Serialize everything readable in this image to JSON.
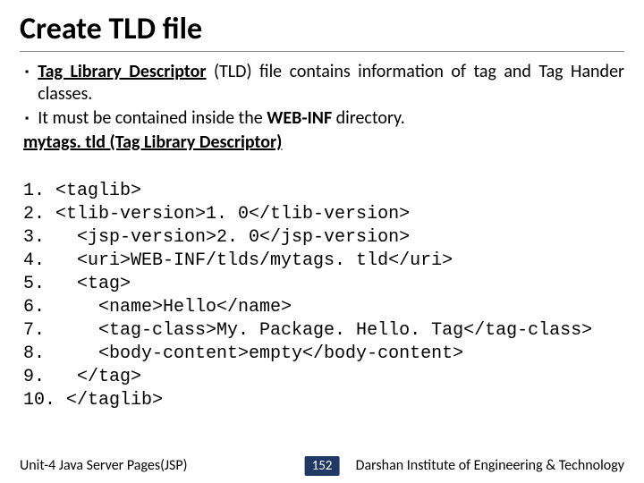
{
  "title": "Create TLD file",
  "bullets": [
    {
      "prefix_bold_underline": "Tag Library Descriptor",
      "rest": " (TLD) file contains information of tag and Tag Hander classes."
    },
    {
      "plain_before": "It must be contained inside the ",
      "bold": "WEB-INF",
      "plain_after": " directory."
    }
  ],
  "subhead": "mytags. tld (Tag Library Descriptor)",
  "code_lines": [
    "1. <taglib>",
    "2. <tlib-version>1. 0</tlib-version>",
    "3.   <jsp-version>2. 0</jsp-version>",
    "4.   <uri>WEB-INF/tlds/mytags. tld</uri>",
    "5.   <tag>",
    "6.     <name>Hello</name>",
    "7.     <tag-class>My. Package. Hello. Tag</tag-class>",
    "8.     <body-content>empty</body-content>",
    "9.   </tag>",
    "10. </taglib>"
  ],
  "footer": {
    "left": "Unit-4 Java Server Pages(JSP)",
    "center": "152",
    "right": "Darshan Institute of Engineering & Technology"
  },
  "marker": "▪"
}
